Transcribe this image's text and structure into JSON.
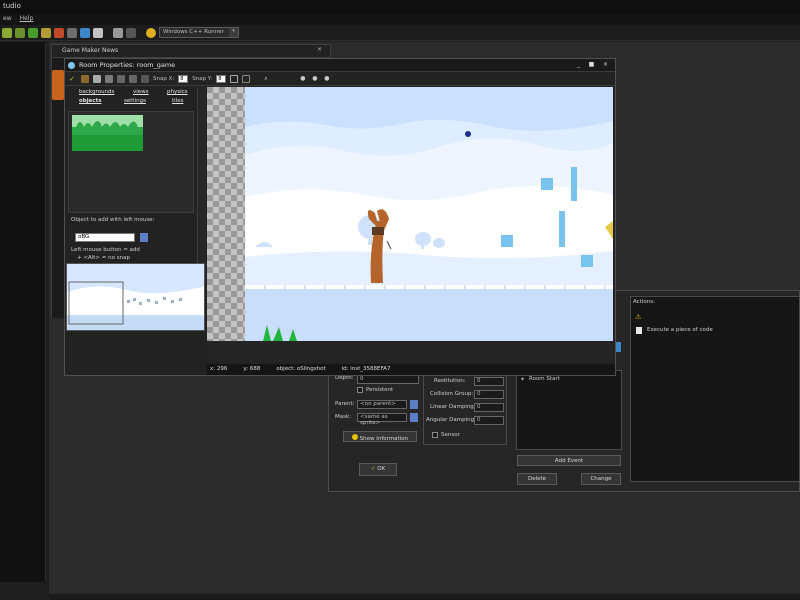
{
  "app": {
    "title": "tudio",
    "menu": [
      "ew",
      "Help"
    ],
    "target_select": "Windows C++ Runner"
  },
  "news_window": {
    "title": "Game Maker News"
  },
  "room_window": {
    "title": "Room Properties: room_game",
    "toolbar": {
      "snap_x_label": "Snap X:",
      "snap_x": "8",
      "snap_y_label": "Snap Y:",
      "snap_y": "8"
    },
    "tabs": [
      "backgrounds",
      "views",
      "physics",
      "objects",
      "settings",
      "tiles"
    ],
    "object_label": "Object to add with left mouse:",
    "object_value": "oBG",
    "help_line1": "Left mouse button = add",
    "help_line2": "+ <Alt> = no snap",
    "status": {
      "x": "x: 296",
      "y": "y: 688",
      "object": "object: oSlingshot",
      "id": "id: inst_3588EFA7"
    }
  },
  "object_panel": {
    "depth_label": "Depth:",
    "depth_value": "0",
    "persistent_label": "Persistent",
    "parent_label": "Parent:",
    "parent_value": "<no parent>",
    "mask_label": "Mask:",
    "mask_value": "<same as sprite>",
    "show_info": "Show Information",
    "ok": "OK",
    "restitution_label": "Restitution:",
    "restitution_value": "0",
    "collision_label": "Collision Group:",
    "collision_value": "0",
    "linear_label": "Linear Damping:",
    "linear_value": "0",
    "angular_label": "Angular Damping:",
    "angular_value": "0",
    "sensor_label": "Sensor",
    "event_item": "Room Start",
    "add_event": "Add Event",
    "delete": "Delete",
    "change": "Change"
  },
  "actions": {
    "title": "Actions:",
    "item": "Execute a piece of code"
  },
  "colors": {
    "sky": "#c9e0ff",
    "cloud": "#ffffff",
    "ice": "#7ec8f0",
    "grass": "#21b53e",
    "slingshot": "#b5652c"
  }
}
